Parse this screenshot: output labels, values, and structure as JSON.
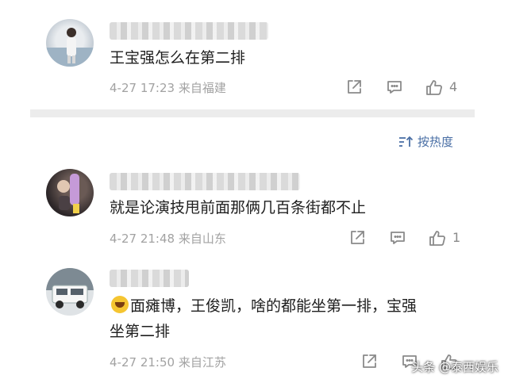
{
  "comments": [
    {
      "text": "王宝强怎么在第二排",
      "date": "4-27",
      "time": "17:23",
      "location": "来自福建",
      "likes": "4"
    },
    {
      "text": "就是论演技甩前面那俩几百条街都不止",
      "date": "4-27",
      "time": "21:48",
      "location": "来自山东",
      "likes": "1"
    },
    {
      "line1": "面瘫博，王俊凯，啥的都能坐第一排，宝强",
      "line2": "坐第二排",
      "date": "4-27",
      "time": "21:50",
      "location": "来自江苏",
      "likes": ""
    }
  ],
  "sort": {
    "label": "按热度",
    "icon": "sort-icon"
  },
  "icons": {
    "share": "share-icon",
    "reply": "comment-icon",
    "like": "thumbs-up-icon"
  },
  "watermark": "头条 @泰西娱乐"
}
